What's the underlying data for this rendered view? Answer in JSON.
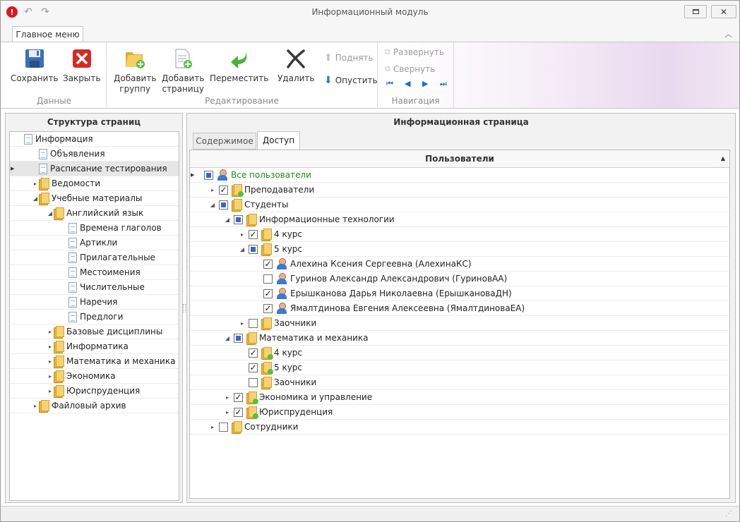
{
  "window": {
    "title": "Информационный модуль"
  },
  "ribbon": {
    "tab": "Главное меню",
    "groups": {
      "data": "Данные",
      "edit": "Редактирование",
      "nav": "Навигация"
    },
    "buttons": {
      "save": "Сохранить",
      "close": "Закрыть",
      "add_group_1": "Добавить",
      "add_group_2": "группу",
      "add_page_1": "Добавить",
      "add_page_2": "страницу",
      "move": "Переместить",
      "delete": "Удалить",
      "up": "Поднять",
      "down": "Опустить",
      "expand": "Развернуть",
      "collapse": "Свернуть"
    }
  },
  "left": {
    "title": "Структура страниц",
    "items": [
      {
        "label": "Информация"
      },
      {
        "label": "Объявления"
      },
      {
        "label": "Расписание тестирования"
      },
      {
        "label": "Ведомости"
      },
      {
        "label": "Учебные материалы"
      },
      {
        "label": "Английский язык"
      },
      {
        "label": "Времена глаголов"
      },
      {
        "label": "Артикли"
      },
      {
        "label": "Прилагательные"
      },
      {
        "label": "Местоимения"
      },
      {
        "label": "Числительные"
      },
      {
        "label": "Наречия"
      },
      {
        "label": "Предлоги"
      },
      {
        "label": "Базовые дисциплины"
      },
      {
        "label": "Информатика"
      },
      {
        "label": "Математика и механика"
      },
      {
        "label": "Экономика"
      },
      {
        "label": "Юриспруденция"
      },
      {
        "label": "Файловый архив"
      }
    ]
  },
  "right": {
    "title": "Информационная страница",
    "tabs": {
      "content": "Содержимое",
      "access": "Доступ"
    },
    "grid_header": "Пользователи",
    "rows": [
      {
        "label": "Все пользователи"
      },
      {
        "label": "Преподаватели"
      },
      {
        "label": "Студенты"
      },
      {
        "label": "Информационные технологии"
      },
      {
        "label": "4 курс"
      },
      {
        "label": "5 курс"
      },
      {
        "label": "Алехина Ксения Сергеевна (АлехинаКС)"
      },
      {
        "label": "Гуринов Александр Александрович (ГуриновАА)"
      },
      {
        "label": "Ерышканова Дарья Николаевна (ЕрышкановаДН)"
      },
      {
        "label": "Ямалтдинова Евгения Алексеевна (ЯмалтдиноваЕА)"
      },
      {
        "label": "Заочники"
      },
      {
        "label": "Математика и механика"
      },
      {
        "label": "4 курс"
      },
      {
        "label": "5 курс"
      },
      {
        "label": "Заочники"
      },
      {
        "label": "Экономика и управление"
      },
      {
        "label": "Юриспруденция"
      },
      {
        "label": "Сотрудники"
      }
    ]
  }
}
